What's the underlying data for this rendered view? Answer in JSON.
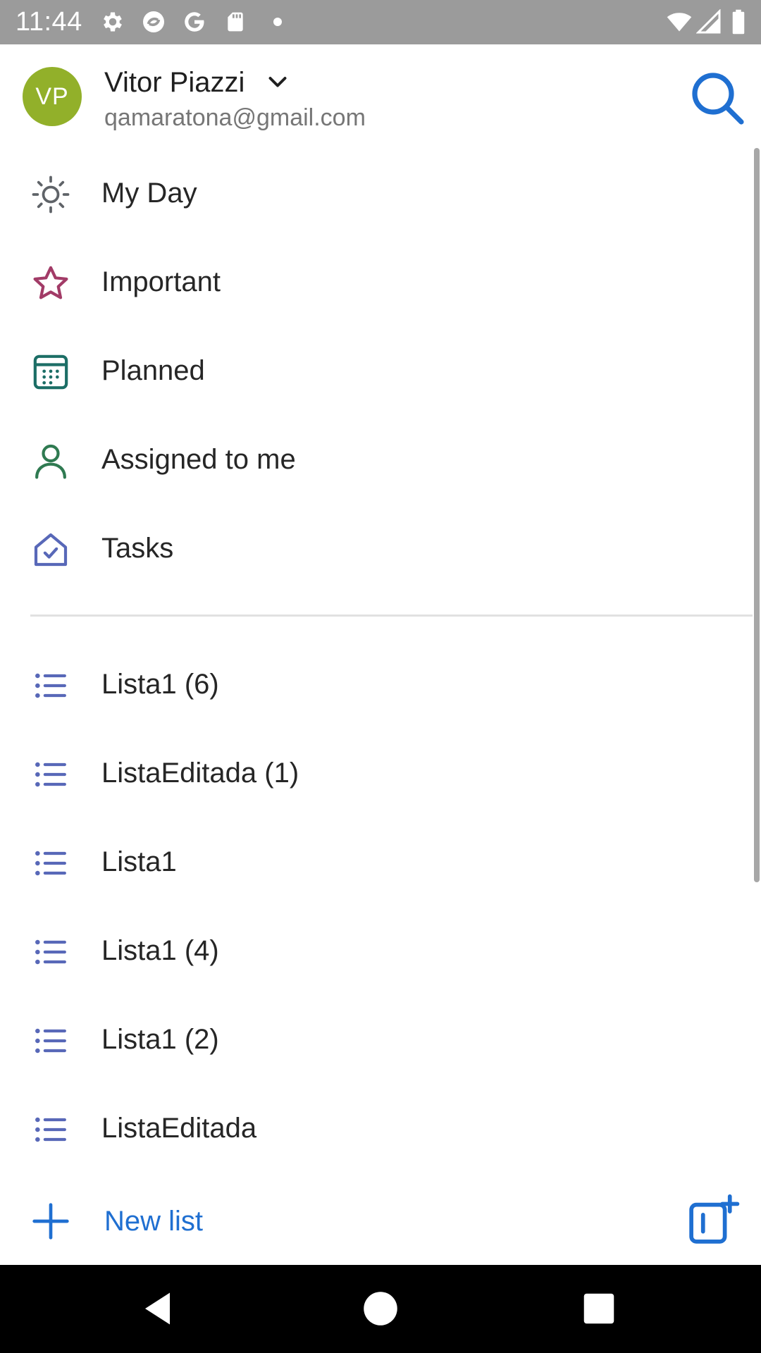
{
  "status_bar": {
    "time": "11:44",
    "icons": [
      "settings-icon",
      "sync-icon",
      "google-icon",
      "sd-card-icon",
      "dot-icon",
      "wifi-icon",
      "signal-icon",
      "battery-icon"
    ]
  },
  "account": {
    "initials": "VP",
    "name": "Vitor Piazzi",
    "email": "qamaratona@gmail.com",
    "avatar_color": "#92b02a"
  },
  "smart_lists": [
    {
      "label": "My Day",
      "icon": "sun-icon",
      "color": "#5f6368"
    },
    {
      "label": "Important",
      "icon": "star-icon",
      "color": "#a23b67"
    },
    {
      "label": "Planned",
      "icon": "calendar-icon",
      "color": "#1c6e66"
    },
    {
      "label": "Assigned to me",
      "icon": "person-icon",
      "color": "#2f7a51"
    },
    {
      "label": "Tasks",
      "icon": "home-check-icon",
      "color": "#5868b8"
    }
  ],
  "custom_lists": [
    {
      "label": "Lista1 (6)",
      "icon": "list-icon"
    },
    {
      "label": "ListaEditada (1)",
      "icon": "list-icon"
    },
    {
      "label": "Lista1",
      "icon": "list-icon"
    },
    {
      "label": "Lista1 (4)",
      "icon": "list-icon"
    },
    {
      "label": "Lista1 (2)",
      "icon": "list-icon"
    },
    {
      "label": "ListaEditada",
      "icon": "list-icon"
    }
  ],
  "footer": {
    "new_list_label": "New list",
    "new_list_icon": "plus-icon",
    "new_group_icon": "new-group-icon"
  },
  "colors": {
    "accent": "#1f6fd1",
    "list_icon": "#5868b8",
    "status_bar": "#9b9b9b"
  }
}
